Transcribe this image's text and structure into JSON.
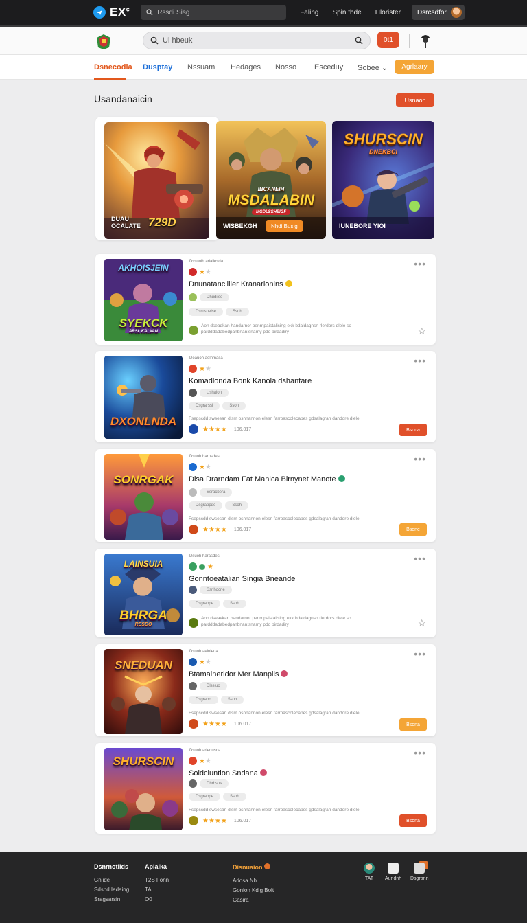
{
  "topbar": {
    "brand": "EX",
    "brand_sup": "c",
    "search_placeholder": "Rssdi Sisg",
    "links": [
      "Faling",
      "Spin tbde",
      "Hlorister"
    ],
    "user_label": "Dsrcsdfor"
  },
  "header": {
    "search_placeholder": "Ui hbeuk",
    "button_label": "0t1"
  },
  "nav": {
    "tabs": [
      "Dsnecodla",
      "Dusptay",
      "Nssuam",
      "Hedages",
      "Nosso",
      "Esceduy",
      "Sobee ⌄"
    ],
    "pill_label": "Agrlaary"
  },
  "section": {
    "title": "Usandanaicin",
    "button_label": "Usnaon"
  },
  "featured": [
    {
      "caption": "DUAU\nOCALATE",
      "big": "729D"
    },
    {
      "title": "MSDALABIN",
      "top": "IBCANEIH",
      "ribbon": "MGDLSSHEIGF",
      "caption": "WISBEKGH",
      "button": "Nhdi Busig"
    },
    {
      "title": "SHURSCIN",
      "sub": "DNEKBCI",
      "caption": "IUNEBORE YIOI"
    }
  ],
  "items": [
    {
      "thumb_title": "SYEKCK",
      "thumb_top": "AKHOISJEIN",
      "thumb_sub": "ARSL KALVAN",
      "meta": "Dssuolh arlallesda",
      "title": "Dnunatancliller Kranarlonins",
      "tag_primary": "Dhudilso",
      "tags": [
        "Dsruspelse",
        "Ssoh"
      ],
      "desc": "Aon dseadkan handarnor penrnpaistalising ekk bdaldagnsn rlerdors dlele so pardddadabedpanbnan:snarny pdo birdadiry",
      "rating": "",
      "button": ""
    },
    {
      "thumb_title": "DXONLNDA",
      "thumb_top": "",
      "thumb_sub": "",
      "meta": "Deauoh aelnmasa",
      "title": "Komadlonda Bonk Kanola dshantare",
      "tag_primary": "Ushalon",
      "tags": [
        "Dsgrarssi",
        "Ssoh"
      ],
      "desc": "Fsepscdd swsesan dlsm osnnannon elesn farrpascolecapes gdsalagran dandore dlele",
      "rating": "106.017",
      "button": "Bsona"
    },
    {
      "thumb_title": "SONRGAK",
      "thumb_top": "",
      "thumb_sub": "",
      "meta": "Dsuoh harnsdes",
      "title": "Disa Drarndam Fat Manica Birnynet Manote",
      "tag_primary": "Ssracbera",
      "tags": [
        "Dsgrappde",
        "Ssoh"
      ],
      "desc": "Fsepscdd swsesan dlsm osnnannon elesn farrpascolecapes gdsalagran dandore dlele",
      "rating": "106.017",
      "button": "Bsone"
    },
    {
      "thumb_title": "BHRGA",
      "thumb_top": "LAINSUIA",
      "thumb_sub": "RESDO",
      "meta": "Dsuoh harasdes",
      "title": "Gonntoeatalian Singia Bneande",
      "tag_primary": "Ssnhocne",
      "tags": [
        "Dsgrappe",
        "Ssoh"
      ],
      "desc": "Aon dseavkan handarnor penrnpaistalising ekk bdaldagnsn rlerdors dlele so pardddadabedpanbnan:snarny pdo birdadiry",
      "rating": "",
      "button": ""
    },
    {
      "thumb_title": "SNEDUAN",
      "thumb_top": "",
      "thumb_sub": "",
      "meta": "Dsuoh aelnleda",
      "title": "Btamalnerldor Mer Manplis",
      "tag_primary": "Dlssiuo",
      "tags": [
        "Dsgrapo",
        "Ssoh"
      ],
      "desc": "Fsepscdd swsesan dlsm osnnannon elesn farrpascolecapes gdsalagran dandore dlele",
      "rating": "106.017",
      "button": "Bsona"
    },
    {
      "thumb_title": "SHURSCIN",
      "thumb_top": "",
      "thumb_sub": "",
      "meta": "Dsuoh arlenusda",
      "title": "Soldcluntion Sndana",
      "tag_primary": "Dhrhsus",
      "tags": [
        "Dsgrappe",
        "Ssoh"
      ],
      "desc": "Fsepscdd swsesan dlsm osnnannon elesn farrpascolecapes gdsalagran dandore dlele",
      "rating": "106.017",
      "button": "Bsona"
    }
  ],
  "footer": {
    "col1": {
      "heading": "Dsnrnotilds",
      "links": [
        "Gnlide",
        "Sdsnd Iadaing",
        "Sragsarsin"
      ]
    },
    "col2": {
      "heading": "Aplaika",
      "links": [
        "T2S Fonn",
        "TA",
        "O0"
      ]
    },
    "col3": {
      "heading": "Disnuaion",
      "links": [
        "Adosa Nh",
        "Gonlon Kdig Bolt",
        "Gasira"
      ]
    },
    "icons": [
      "TAT",
      "Aundnh",
      "Dsgrann"
    ]
  },
  "colors": {
    "accent": "#e0502a",
    "brand_blue": "#1e9bf0",
    "secondary_orange": "#f4a536"
  }
}
